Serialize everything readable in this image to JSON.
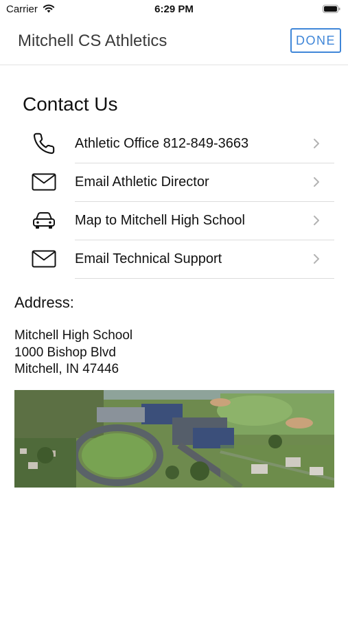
{
  "status_bar": {
    "carrier": "Carrier",
    "time": "6:29 PM"
  },
  "nav": {
    "title": "Mitchell CS Athletics",
    "done_label": "DONE",
    "accent_color": "#3f86d8"
  },
  "contact": {
    "heading": "Contact Us",
    "items": [
      {
        "icon": "phone-icon",
        "label": "Athletic Office 812-849-3663"
      },
      {
        "icon": "envelope-icon",
        "label": "Email Athletic Director"
      },
      {
        "icon": "car-icon",
        "label": "Map to Mitchell High School"
      },
      {
        "icon": "envelope-icon",
        "label": "Email Technical Support"
      }
    ]
  },
  "address": {
    "heading": "Address:",
    "lines": [
      "Mitchell High School",
      "1000 Bishop Blvd",
      "Mitchell, IN 47446"
    ]
  }
}
